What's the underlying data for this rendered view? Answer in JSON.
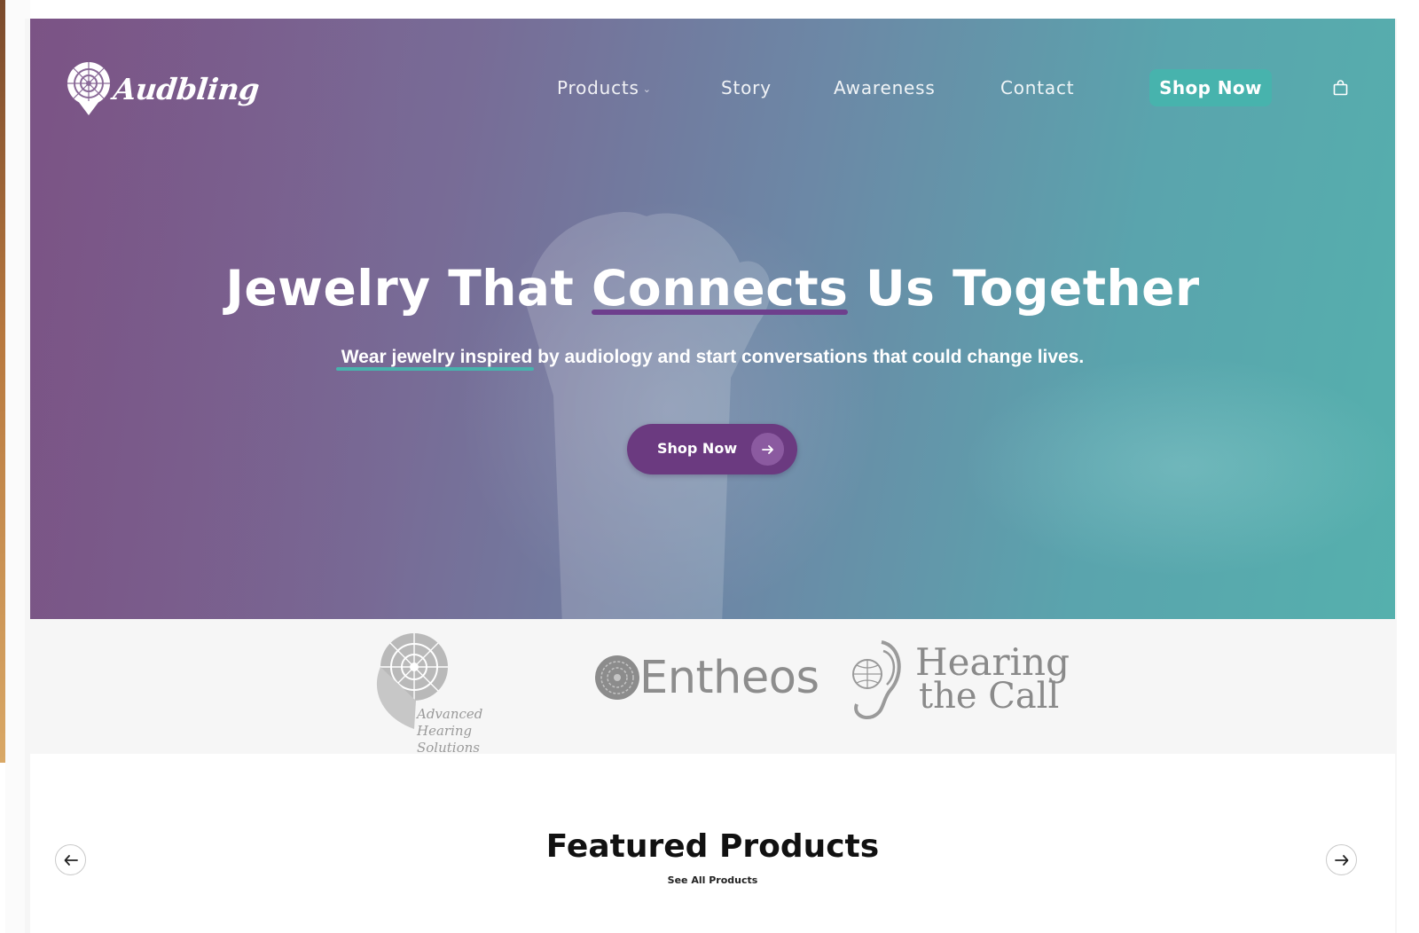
{
  "brand": {
    "name": "Audbling"
  },
  "nav": {
    "items": [
      {
        "label": "Products",
        "has_dropdown": true
      },
      {
        "label": "Story"
      },
      {
        "label": "Awareness"
      },
      {
        "label": "Contact"
      }
    ],
    "shop_button": "Shop Now",
    "cart_icon": "shopping-bag-icon"
  },
  "hero": {
    "title_part1": "Jewelry That ",
    "title_highlight": "Connects",
    "title_part2": " Us Together",
    "subtitle_highlight": "Wear jewelry inspired",
    "subtitle_rest": " by audiology and start conversations that could change lives.",
    "cta_label": "Shop Now",
    "cta_icon": "arrow-right-icon"
  },
  "partners": {
    "ahs": {
      "line1": "Advanced",
      "line2": "Hearing Solutions"
    },
    "entheos": {
      "name": "Entheos"
    },
    "htc": {
      "line1": "Hearing",
      "line2": "the Call"
    }
  },
  "featured": {
    "title": "Featured Products",
    "see_all": "See All Products",
    "prev_icon": "arrow-left-icon",
    "next_icon": "arrow-right-icon"
  },
  "colors": {
    "accent_teal": "#47b3ad",
    "accent_purple": "#6b3a80",
    "hero_left": "#7d5a8c",
    "hero_right": "#55b0ad"
  }
}
